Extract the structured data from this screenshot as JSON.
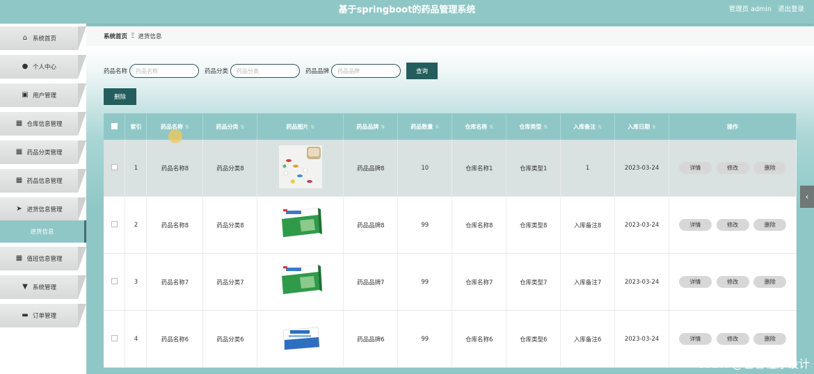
{
  "header": {
    "title": "基于springboot的药品管理系统",
    "user": "管理员 admin",
    "logout": "退出登录"
  },
  "sidebar": {
    "items": [
      {
        "label": "系统首页",
        "icon": "home-icon",
        "glyph": "⌂"
      },
      {
        "label": "个人中心",
        "icon": "user-icon",
        "glyph": "●"
      },
      {
        "label": "用户管理",
        "icon": "user-card-icon",
        "glyph": "▣"
      },
      {
        "label": "仓库信息管理",
        "icon": "grid-icon",
        "glyph": "▦"
      },
      {
        "label": "药品分类管理",
        "icon": "grid-icon",
        "glyph": "▦"
      },
      {
        "label": "药品信息管理",
        "icon": "grid-icon",
        "glyph": "▦"
      },
      {
        "label": "进货信息管理",
        "icon": "send-icon",
        "glyph": "➤"
      },
      {
        "label": "值班信息管理",
        "icon": "grid-icon",
        "glyph": "▦"
      },
      {
        "label": "系统管理",
        "icon": "system-icon",
        "glyph": "▼"
      },
      {
        "label": "订单管理",
        "icon": "order-icon",
        "glyph": "▬"
      }
    ],
    "sub_active": "进货信息"
  },
  "breadcrumb": {
    "home": "系统首页",
    "sep": "Ξ",
    "current": "进货信息"
  },
  "search": {
    "name_label": "药品名称",
    "name_placeholder": "药品名称",
    "category_label": "药品分类",
    "category_placeholder": "药品分类",
    "brand_label": "药品品牌",
    "brand_placeholder": "药品品牌",
    "query_button": "查询"
  },
  "delete_button": "删除",
  "table": {
    "headers": [
      "索引",
      "药品名称",
      "药品分类",
      "药品图片",
      "药品品牌",
      "药品数量",
      "仓库名称",
      "仓库类型",
      "入库备注",
      "入库日期",
      "操作"
    ],
    "rows": [
      {
        "index": "1",
        "name": "药品名称8",
        "category": "药品分类8",
        "image": "pills-image",
        "brand": "药品品牌8",
        "qty": "10",
        "warehouse": "仓库名称1",
        "wtype": "仓库类型1",
        "note": "1",
        "date": "2023-03-24"
      },
      {
        "index": "2",
        "name": "药品名称8",
        "category": "药品分类8",
        "image": "green-box-image",
        "brand": "药品品牌8",
        "qty": "99",
        "warehouse": "仓库名称8",
        "wtype": "仓库类型8",
        "note": "入库备注8",
        "date": "2023-03-24"
      },
      {
        "index": "3",
        "name": "药品名称7",
        "category": "药品分类7",
        "image": "green-box-image",
        "brand": "药品品牌7",
        "qty": "99",
        "warehouse": "仓库名称7",
        "wtype": "仓库类型7",
        "note": "入库备注7",
        "date": "2023-03-24"
      },
      {
        "index": "4",
        "name": "药品名称6",
        "category": "药品分类6",
        "image": "blue-box-image",
        "brand": "药品品牌6",
        "qty": "99",
        "warehouse": "仓库名称6",
        "wtype": "仓库类型6",
        "note": "入库备注6",
        "date": "2023-03-24"
      }
    ],
    "actions": {
      "detail": "详情",
      "edit": "修改",
      "delete": "删除"
    }
  },
  "watermark": "CSDN @艺馨程序设计"
}
